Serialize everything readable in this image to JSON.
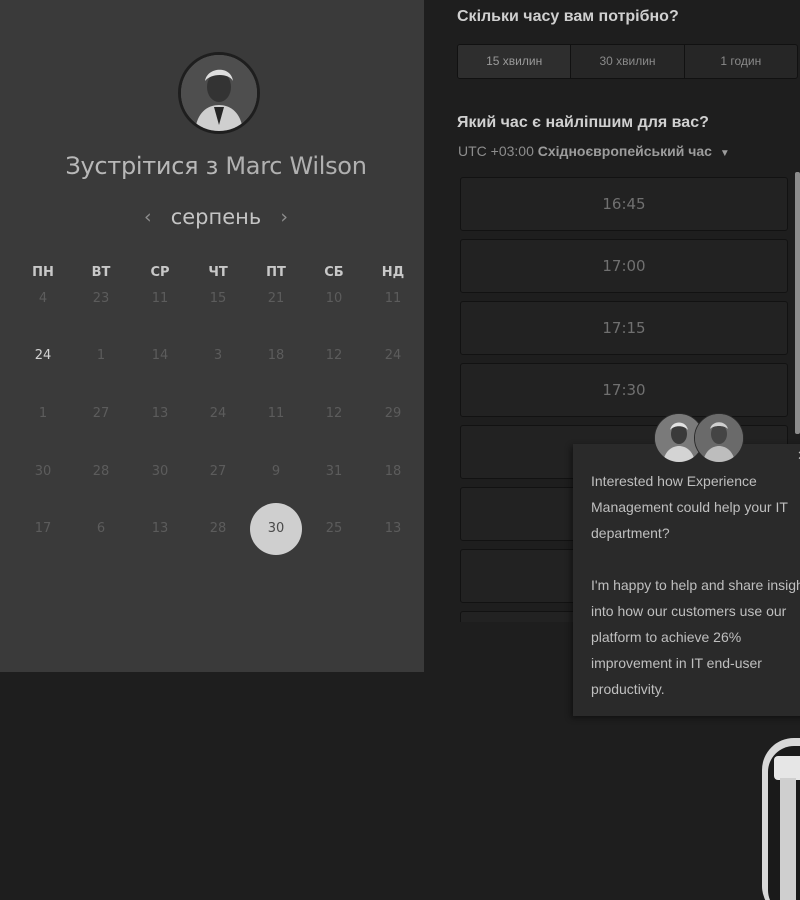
{
  "host": {
    "title_prefix": "Зустрітися з",
    "name": "Marc Wilson",
    "avatar_icon": "person-portrait-icon"
  },
  "calendar": {
    "month": "серпень",
    "weekdays": [
      "ПН",
      "ВТ",
      "СР",
      "ЧТ",
      "ПТ",
      "СБ",
      "НД"
    ],
    "weeks": [
      [
        "4",
        "23",
        "11",
        "15",
        "21",
        "10",
        "11"
      ],
      [
        "24",
        "1",
        "14",
        "3",
        "18",
        "12",
        "24"
      ],
      [
        "1",
        "27",
        "13",
        "24",
        "11",
        "12",
        "29"
      ],
      [
        "30",
        "28",
        "30",
        "27",
        "9",
        "31",
        "18"
      ],
      [
        "17",
        "6",
        "13",
        "28",
        "30",
        "25",
        "13"
      ]
    ],
    "bright_day": "24",
    "selected_day": "30"
  },
  "duration": {
    "question": "Скільки часу вам потрібно?",
    "options": [
      "15 хвилин",
      "30 хвилин",
      "1 годин"
    ],
    "selected": "15 хвилин"
  },
  "time": {
    "question": "Який час є найліпшим для вас?",
    "timezone_offset": "UTC +03:00",
    "timezone_name": "Східноєвропейський час",
    "slots": [
      "16:45",
      "17:00",
      "17:15",
      "17:30",
      "",
      "",
      "",
      ""
    ]
  },
  "chat": {
    "paragraph_1": "Interested how Experience Management could help your IT department?",
    "paragraph_2": "I'm happy to help and share insight into how our customers use our platform to achieve 26% improvement in IT end-user productivity.",
    "close_icon": "close-icon"
  },
  "colors": {
    "left_panel_bg": "#3a3a3a",
    "page_bg": "#1e1e1e",
    "selected_day_bg": "#cfcfcf"
  }
}
